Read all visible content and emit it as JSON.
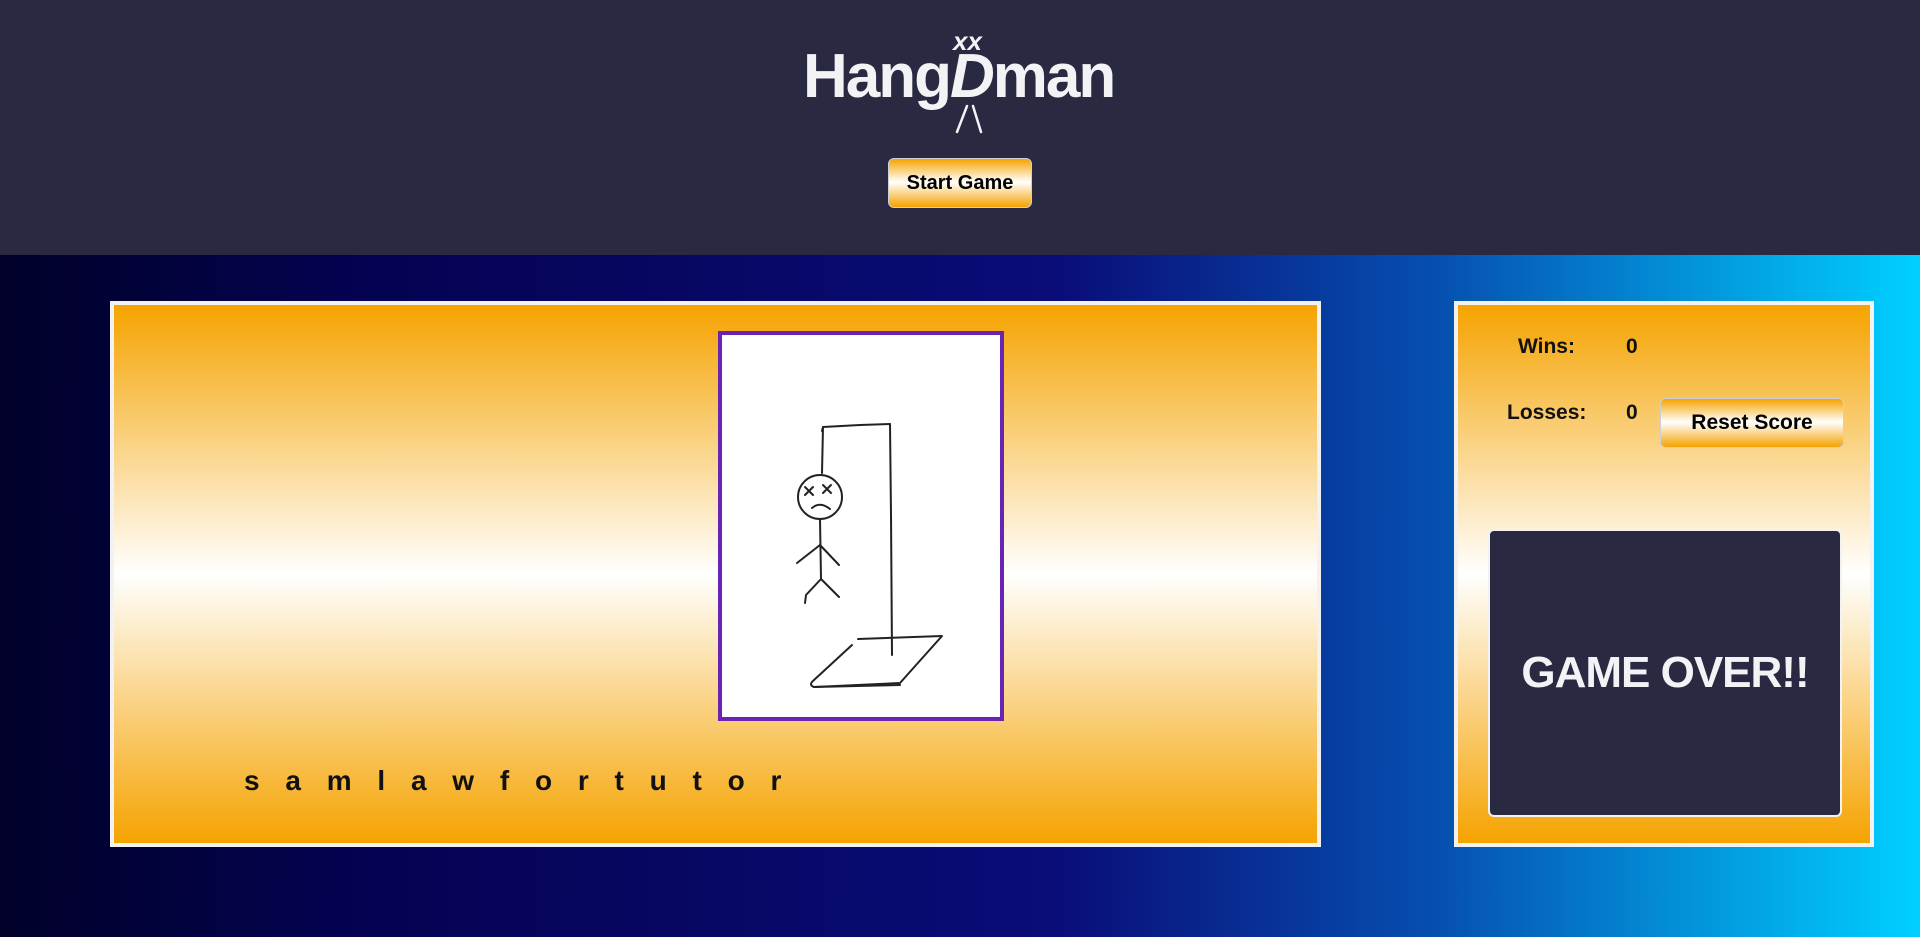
{
  "header": {
    "logo": {
      "pre": "Hang",
      "highlight": "D",
      "post": "man",
      "eyes": "xx",
      "legs": "/\\"
    },
    "start_button_label": "Start Game"
  },
  "game": {
    "word_display": "s a m l a w f o r t u t o r",
    "drawing_icon": "hangman-complete-icon"
  },
  "score": {
    "wins_label": "Wins:",
    "wins_value": "0",
    "losses_label": "Losses:",
    "losses_value": "0",
    "reset_button_label": "Reset Score",
    "status_message": "GAME OVER!!"
  },
  "colors": {
    "header_bg": "#292942",
    "gold": "#f5a300",
    "frame_border": "#6a24b4",
    "status_bg": "#292942"
  }
}
